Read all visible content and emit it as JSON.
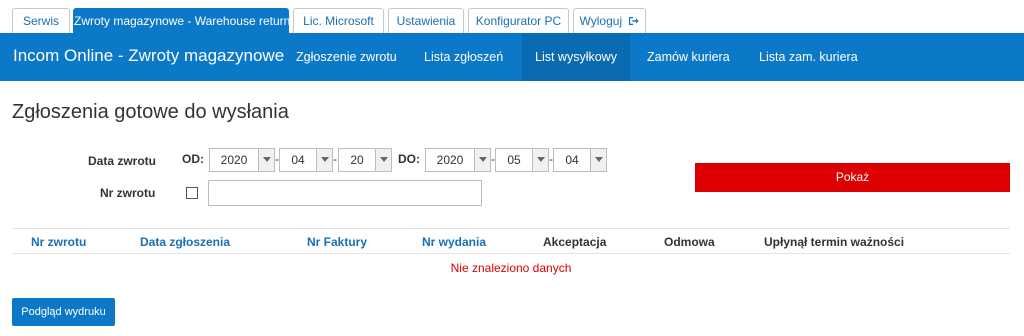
{
  "tabs": [
    {
      "label": "Serwis"
    },
    {
      "label": "Zwroty magazynowe - Warehouse returns"
    },
    {
      "label": "Lic. Microsoft"
    },
    {
      "label": "Ustawienia"
    },
    {
      "label": "Konfigurator PC"
    },
    {
      "label": "Wyloguj"
    }
  ],
  "navbar": {
    "brand": "Incom Online - Zwroty magazynowe",
    "links": [
      {
        "label": "Zgłoszenie zwrotu"
      },
      {
        "label": "Lista zgłoszeń"
      },
      {
        "label": "List wysyłkowy"
      },
      {
        "label": "Zamów kuriera"
      },
      {
        "label": "Lista zam. kuriera"
      }
    ]
  },
  "page": {
    "title": "Zgłoszenia gotowe do wysłania"
  },
  "filters": {
    "date_label": "Data zwrotu",
    "from_label": "OD:",
    "to_label": "DO:",
    "from": {
      "year": "2020",
      "month": "04",
      "day": "20"
    },
    "to": {
      "year": "2020",
      "month": "05",
      "day": "04"
    },
    "number_label": "Nr zwrotu",
    "number_value": "",
    "show_button": "Pokaż"
  },
  "table": {
    "columns": [
      {
        "label": "Nr zwrotu"
      },
      {
        "label": "Data zgłoszenia"
      },
      {
        "label": "Nr Faktury"
      },
      {
        "label": "Nr wydania"
      },
      {
        "label": "Akceptacja"
      },
      {
        "label": "Odmowa"
      },
      {
        "label": "Upłynął termin ważności"
      }
    ],
    "empty_message": "Nie znaleziono danych"
  },
  "footer": {
    "print_preview_button": "Podgląd wydruku"
  },
  "colors": {
    "primary_blue": "#0c78c8",
    "accent_red": "#dd0000",
    "link_blue": "#1a6fb5"
  }
}
